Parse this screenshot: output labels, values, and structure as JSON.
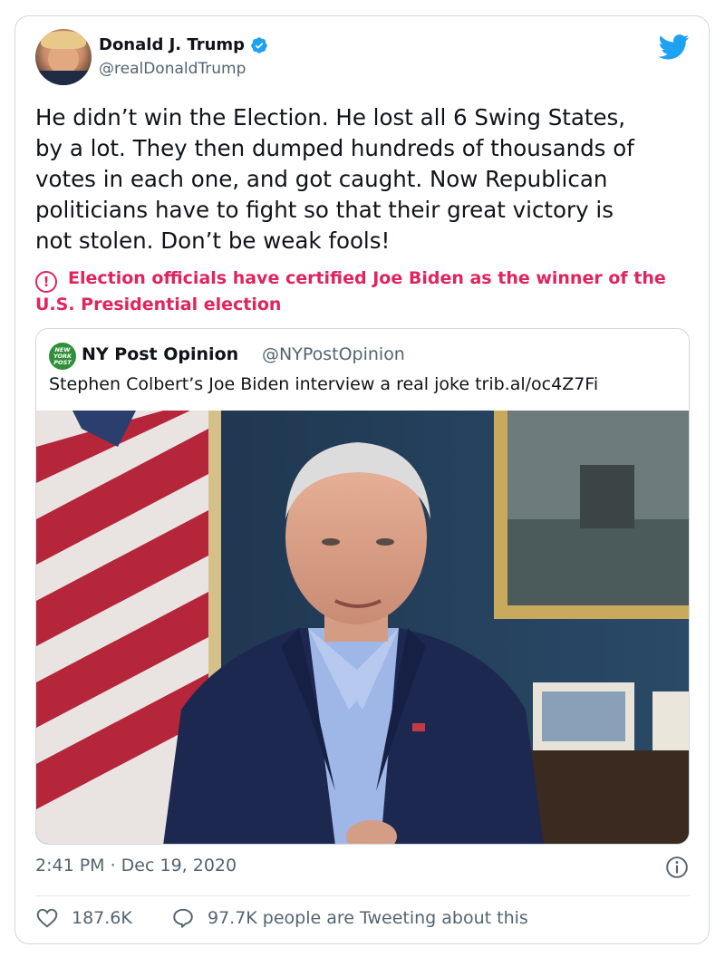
{
  "author": {
    "name": "Donald J. Trump",
    "handle": "@realDonaldTrump"
  },
  "tweet": {
    "text": "He didn’t win the Election. He lost all 6 Swing States,\nby a lot. They then dumped hundreds of thousands of\nvotes in each one, and got caught. Now Republican\npoliticians have to fight so that their great victory is\nnot stolen. Don’t be weak fools!",
    "notice": "Election officials have certified Joe Biden as the winner of the U.S. Presidential election",
    "notice_icon": "!"
  },
  "quoted": {
    "name": "NY Post Opinion",
    "handle": "@NYPostOpinion",
    "avatar_text": "NEW YORK POST",
    "text": "Stephen Colbert’s Joe Biden interview a real joke trib.al/oc4Z7Fi"
  },
  "meta": {
    "timestamp": "2:41 PM · Dec 19, 2020"
  },
  "stats": {
    "likes": "187.6K",
    "tweeting": "97.7K people are Tweeting about this"
  },
  "icons": {
    "verified": "verified-badge-icon",
    "bird": "twitter-bird-icon",
    "info": "info-icon",
    "heart": "heart-icon",
    "reply": "speech-bubble-icon"
  },
  "colors": {
    "accent": "#1da1f2",
    "notice": "#e0245e",
    "secondary_text": "#536471",
    "nypost_green": "#2f8f3a"
  }
}
